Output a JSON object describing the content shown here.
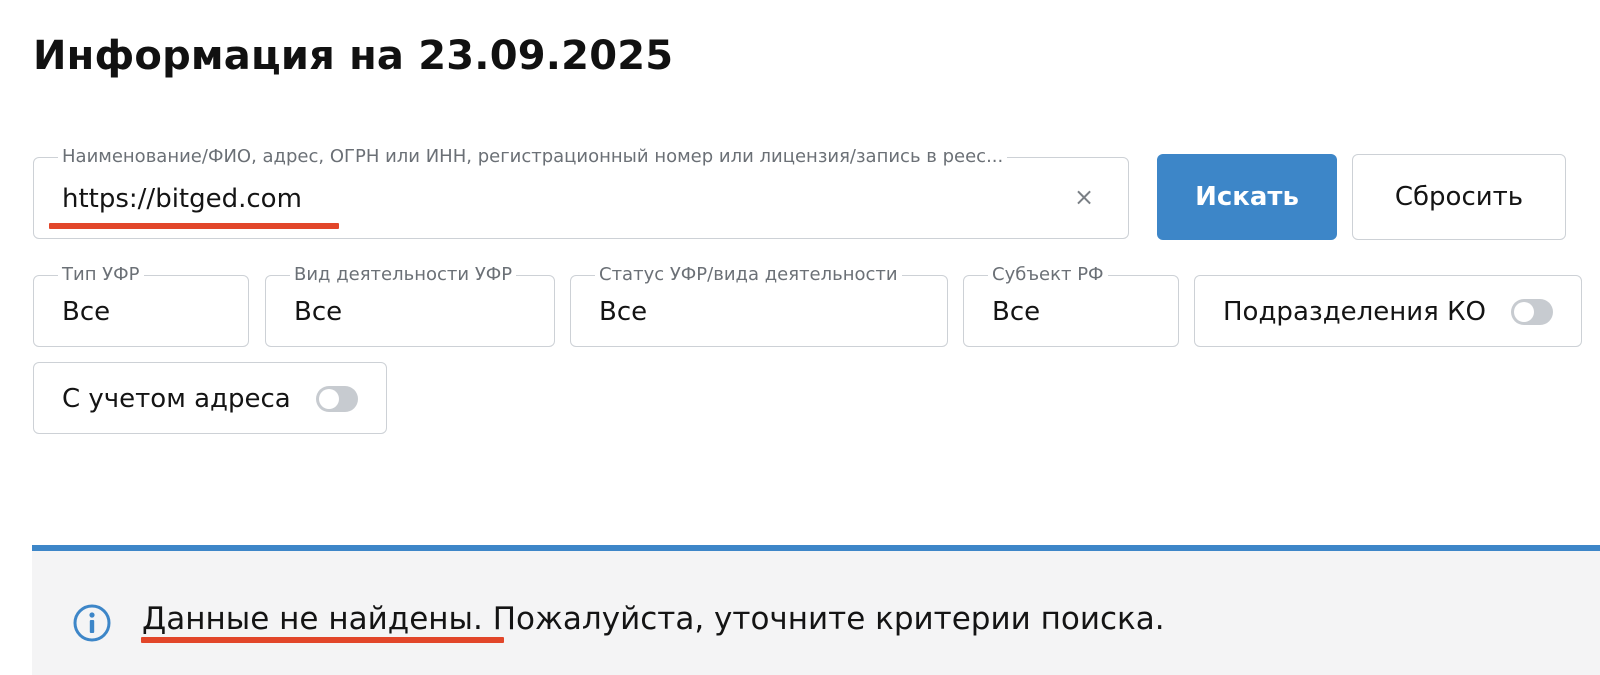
{
  "page": {
    "title": "Информация на 23.09.2025"
  },
  "search": {
    "label": "Наименование/ФИО, адрес, ОГРН или ИНН, регистрационный номер или лицензия/запись в реес...",
    "value": "https://bitged.com",
    "clear_icon": "×",
    "search_button": "Искать",
    "reset_button": "Сбросить"
  },
  "filters": {
    "type": {
      "label": "Тип УФР",
      "value": "Все"
    },
    "activity": {
      "label": "Вид деятельности УФР",
      "value": "Все"
    },
    "status": {
      "label": "Статус УФР/вида деятельности",
      "value": "Все"
    },
    "region": {
      "label": "Субъект РФ",
      "value": "Все"
    }
  },
  "toggles": {
    "branches": {
      "label": "Подразделения КО",
      "state": "off"
    },
    "address": {
      "label": "С учетом адреса",
      "state": "off"
    }
  },
  "notice": {
    "icon": "info-icon",
    "emphasis": "Данные не найдены",
    "rest": ". Пожалуйста, уточните критерии поиска."
  },
  "colors": {
    "accent": "#3d86c8",
    "annotation_underline": "#e2462a",
    "notice_background": "#f4f4f5",
    "field_border": "#cdd1d6"
  }
}
